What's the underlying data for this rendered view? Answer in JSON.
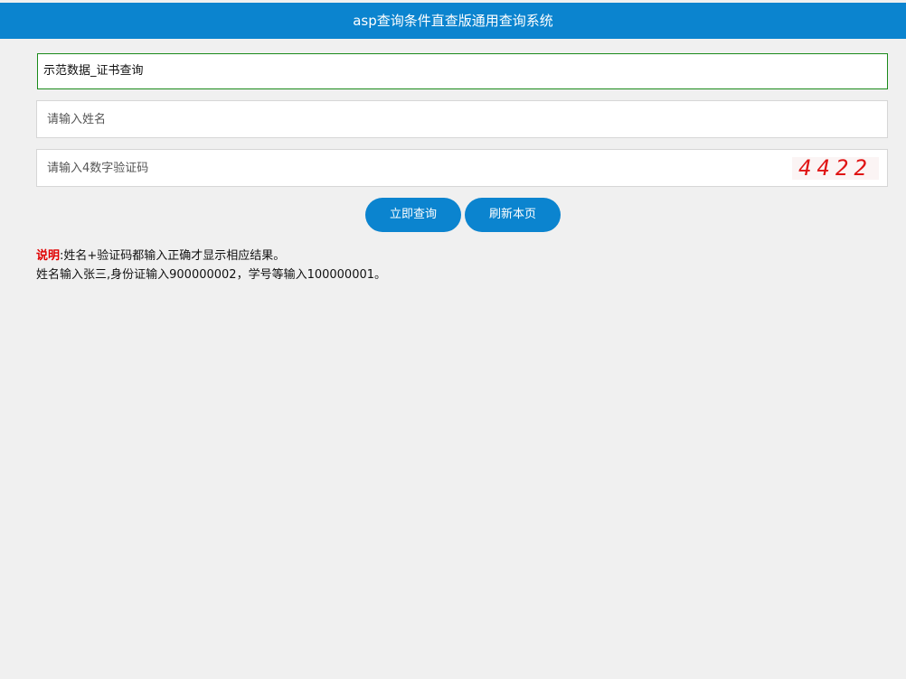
{
  "header": {
    "title": "asp查询条件直查版通用查询系统"
  },
  "form": {
    "table_select": {
      "value": "示范数据_证书查询"
    },
    "name_input": {
      "placeholder": "请输入姓名",
      "value": ""
    },
    "captcha_input": {
      "placeholder": "请输入4数字验证码",
      "value": ""
    },
    "captcha_image": {
      "text": "4422",
      "color": "#e01414"
    }
  },
  "buttons": {
    "query_label": "立即查询",
    "refresh_label": "刷新本页"
  },
  "notes": {
    "label": "说明",
    "line1": ":姓名+验证码都输入正确才显示相应结果。",
    "line2": "姓名输入张三,身份证输入900000002，学号等输入100000001。"
  },
  "colors": {
    "accent": "#0b84cf",
    "background": "#f0f0f0",
    "note_label": "#e00000",
    "select_border": "#1a8a1a"
  }
}
